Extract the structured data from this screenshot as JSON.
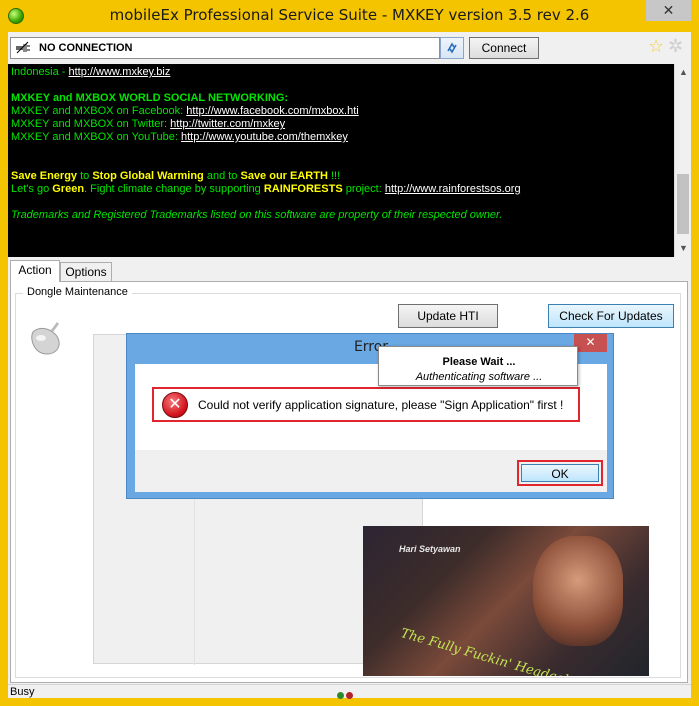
{
  "window": {
    "title": "mobileEx Professional Service Suite - MXKEY version 3.5 rev 2.6",
    "close_glyph": "✕"
  },
  "toolbar": {
    "connection_status": "NO CONNECTION",
    "connect_label": "Connect"
  },
  "console": {
    "line1_prefix": "Indonesia - ",
    "line1_link": "http://www.mxkey.biz",
    "social_heading": "MXKEY and MXBOX WORLD SOCIAL NETWORKING:",
    "facebook_prefix": "MXKEY and MXBOX on Facebook: ",
    "facebook_link": "http://www.facebook.com/mxbox.hti",
    "twitter_prefix": "MXKEY and MXBOX on Twitter: ",
    "twitter_link": "http://twitter.com/mxkey",
    "youtube_prefix": "MXKEY and MXBOX on YouTube: ",
    "youtube_link": "http://www.youtube.com/themxkey",
    "save_energy": "Save Energy",
    "to1": " to ",
    "stop_warming": "Stop Global Warming",
    "and_to": " and to ",
    "save_earth": "Save our EARTH",
    "exclaim": " !!!",
    "lets_go": "Let's go ",
    "green": "Green",
    "fight_text": ". Fight climate change by supporting ",
    "rainforests": "RAINFORESTS",
    "project": " project: ",
    "rain_link": "http://www.rainforestsos.org",
    "trademark": "Trademarks and Registered Trademarks listed on this software are property of their respected owner."
  },
  "tabs": [
    {
      "label": "Action"
    },
    {
      "label": "Options"
    }
  ],
  "panel": {
    "group_label": "Dongle Maintenance",
    "update_hti_label": "Update HTI",
    "check_updates_label": "Check For Updates",
    "banner_name": "Hari Setyawan",
    "banner_caption": "The Fully Fuckin' Headache Lion"
  },
  "statusbar": {
    "text": "Busy",
    "dot_colors": [
      "#2c8a2c",
      "#b3232a"
    ]
  },
  "error_dialog": {
    "title": "Error",
    "close_glyph": "✕",
    "message": "Could not verify application signature, please \"Sign Application\" first !",
    "ok_label": "OK",
    "icon_glyph": "✕"
  },
  "wait_dialog": {
    "title": "Please Wait ...",
    "subtitle": "Authenticating software ..."
  },
  "colors": {
    "accent": "#f4c400",
    "console_bg": "#000000",
    "console_text": "#00e400",
    "highlight": "#e0252f"
  }
}
